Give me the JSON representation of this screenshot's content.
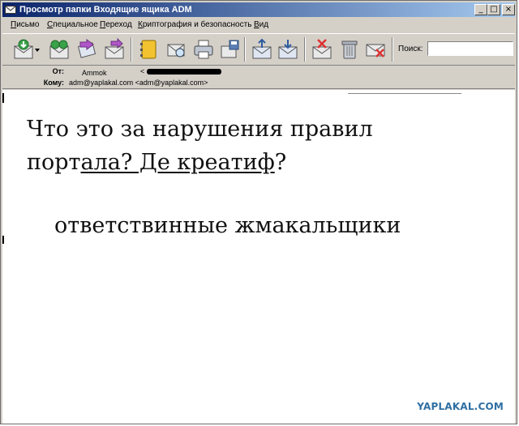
{
  "window": {
    "title": "Просмотр папки Входящие ящика ADM",
    "controls": {
      "minimize": "_",
      "maximize": "□",
      "close": "×"
    }
  },
  "menu": {
    "items": [
      {
        "first": "П",
        "rest": "исьмо"
      },
      {
        "first": "С",
        "rest": "пециальное"
      },
      {
        "first": "П",
        "rest": "ереход"
      },
      {
        "first": "К",
        "rest": "риптография и безопасность"
      },
      {
        "first": "В",
        "rest": "ид"
      }
    ]
  },
  "toolbar": {
    "icons": [
      "get-mail-icon",
      "dropdown-arrow-icon",
      "receive-send-icon",
      "reply-icon",
      "forward-icon",
      "address-book-icon",
      "print-preview-icon",
      "print-icon",
      "save-icon",
      "move-icon",
      "copy-icon",
      "delete-icon",
      "trash-icon",
      "block-sender-icon"
    ],
    "search_label": "Поиск:",
    "search_value": ""
  },
  "header": {
    "from_label": "От:",
    "from_value": "Ammok",
    "from_email_open": "<",
    "to_label": "Кому:",
    "to_value": "adm@yaplakal.com <adm@yaplakal.com>"
  },
  "message": {
    "line1": "Что это за нарушения правил",
    "line2_start": "порт",
    "line2_underlined": "ала? Де креатиф",
    "line2_end": "?",
    "line3": "ответствинные жмакальщики",
    "watermark": "YAPLAKAL.COM"
  },
  "colors": {
    "title_start": "#0a246a",
    "title_end": "#a6caf0",
    "chrome": "#d4d0c8",
    "watermark": "#2f6fa3"
  }
}
